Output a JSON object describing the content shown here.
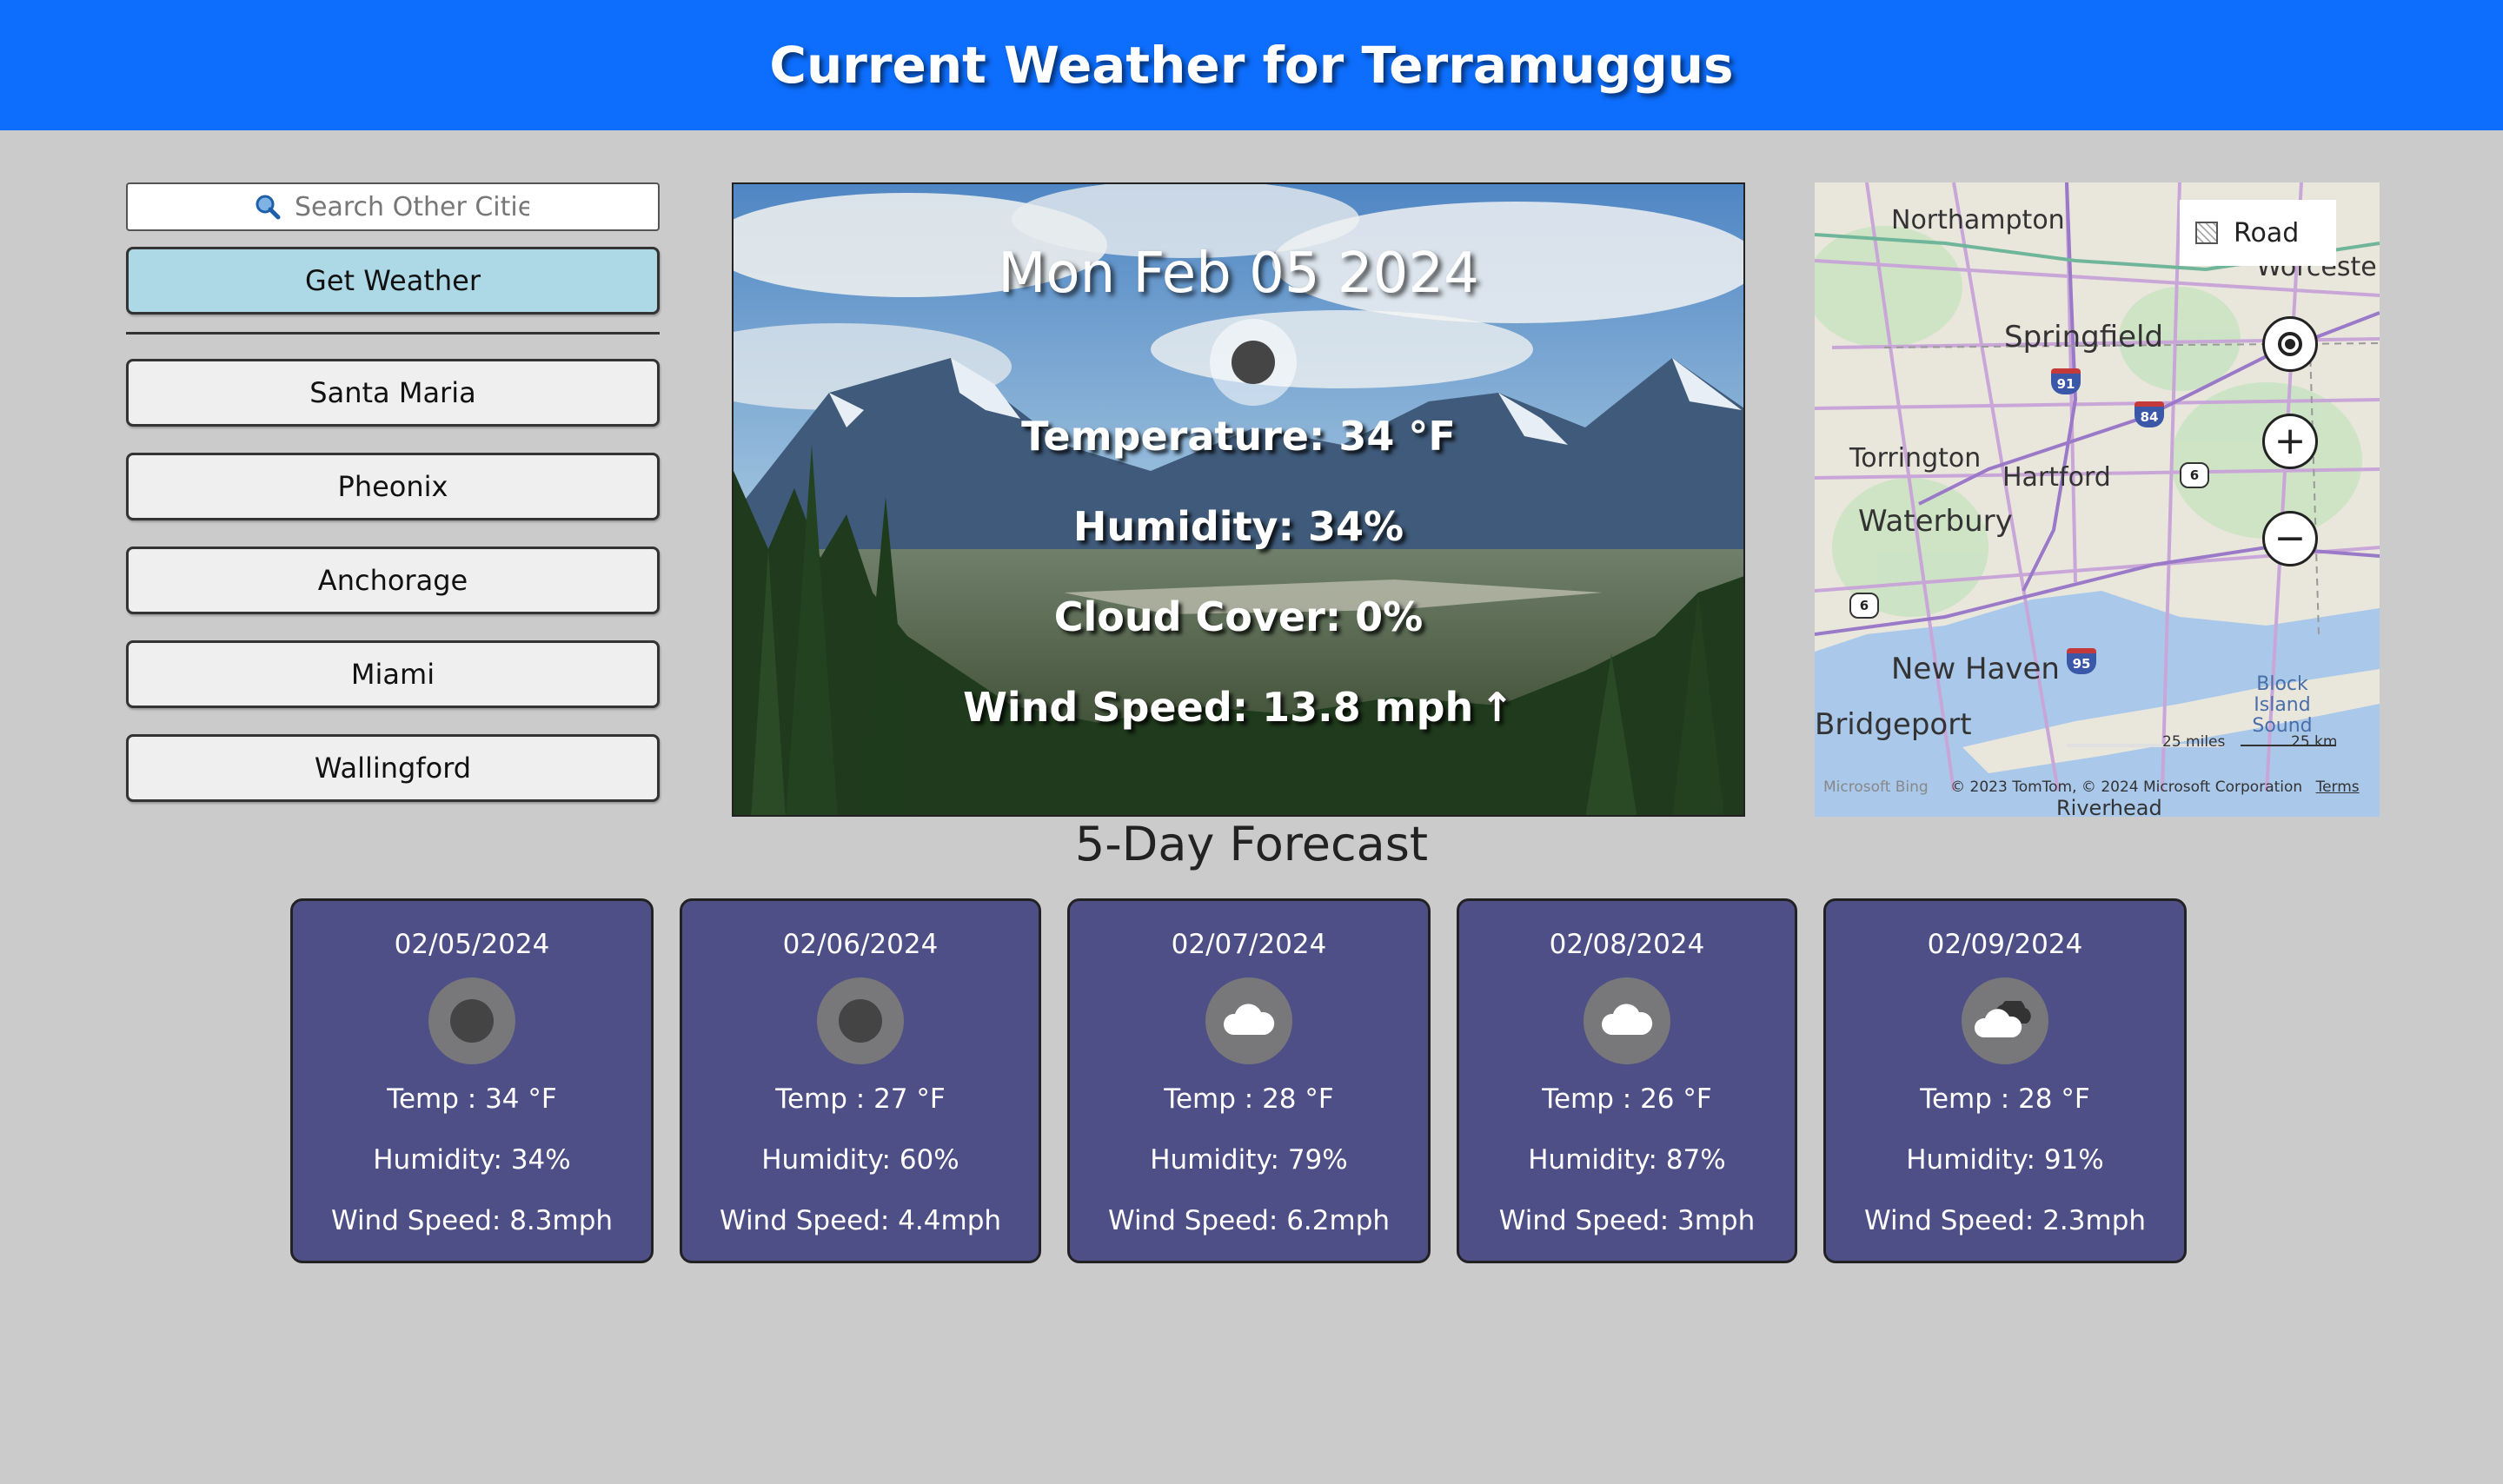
{
  "header": {
    "title": "Current Weather for Terramuggus"
  },
  "sidebar": {
    "search_placeholder": "Search Other Cities",
    "get_weather_label": "Get Weather",
    "cities": [
      "Santa Maria",
      "Pheonix",
      "Anchorage",
      "Miami",
      "Wallingford"
    ]
  },
  "current": {
    "date": "Mon Feb 05 2024",
    "temperature": "Temperature: 34 °F",
    "humidity": "Humidity: 34%",
    "cloud_cover": "Cloud Cover: 0%",
    "wind_speed": "Wind Speed: 13.8 mph",
    "wind_arrow": "↑",
    "icon": "clear-night-icon"
  },
  "map": {
    "style_label": "Road",
    "places": {
      "northampton": "Northampton",
      "worcester": "Worceste",
      "springfield": "Springfield",
      "torrington": "Torrington",
      "hartford": "Hartford",
      "waterbury": "Waterbury",
      "new_haven": "New Haven",
      "bridgeport": "Bridgeport",
      "riverhead": "Riverhead",
      "block_island_sound": "Block Island Sound"
    },
    "highways": {
      "i91": "91",
      "i84": "84",
      "i95": "95",
      "r6a": "6",
      "r6b": "6"
    },
    "scale_miles": "25 miles",
    "scale_km": "25 km",
    "brand": "Microsoft Bing",
    "attribution": "© 2023 TomTom, © 2024 Microsoft Corporation",
    "terms": "Terms"
  },
  "forecast": {
    "title": "5-Day Forecast",
    "days": [
      {
        "date": "02/05/2024",
        "temp": "Temp : 34 °F",
        "humidity": "Humidity: 34%",
        "wind": "Wind Speed: 8.3mph",
        "icon": "clear-night-icon"
      },
      {
        "date": "02/06/2024",
        "temp": "Temp : 27 °F",
        "humidity": "Humidity: 60%",
        "wind": "Wind Speed: 4.4mph",
        "icon": "clear-night-icon"
      },
      {
        "date": "02/07/2024",
        "temp": "Temp : 28 °F",
        "humidity": "Humidity: 79%",
        "wind": "Wind Speed: 6.2mph",
        "icon": "cloud-icon"
      },
      {
        "date": "02/08/2024",
        "temp": "Temp : 26 °F",
        "humidity": "Humidity: 87%",
        "wind": "Wind Speed: 3mph",
        "icon": "cloud-icon"
      },
      {
        "date": "02/09/2024",
        "temp": "Temp : 28 °F",
        "humidity": "Humidity: 91%",
        "wind": "Wind Speed: 2.3mph",
        "icon": "broken-clouds-icon"
      }
    ]
  },
  "colors": {
    "header": "#0d6efd",
    "page_bg": "#cbcbcb",
    "primary_button": "#add8e6",
    "card_bg": "#4f4f87"
  }
}
